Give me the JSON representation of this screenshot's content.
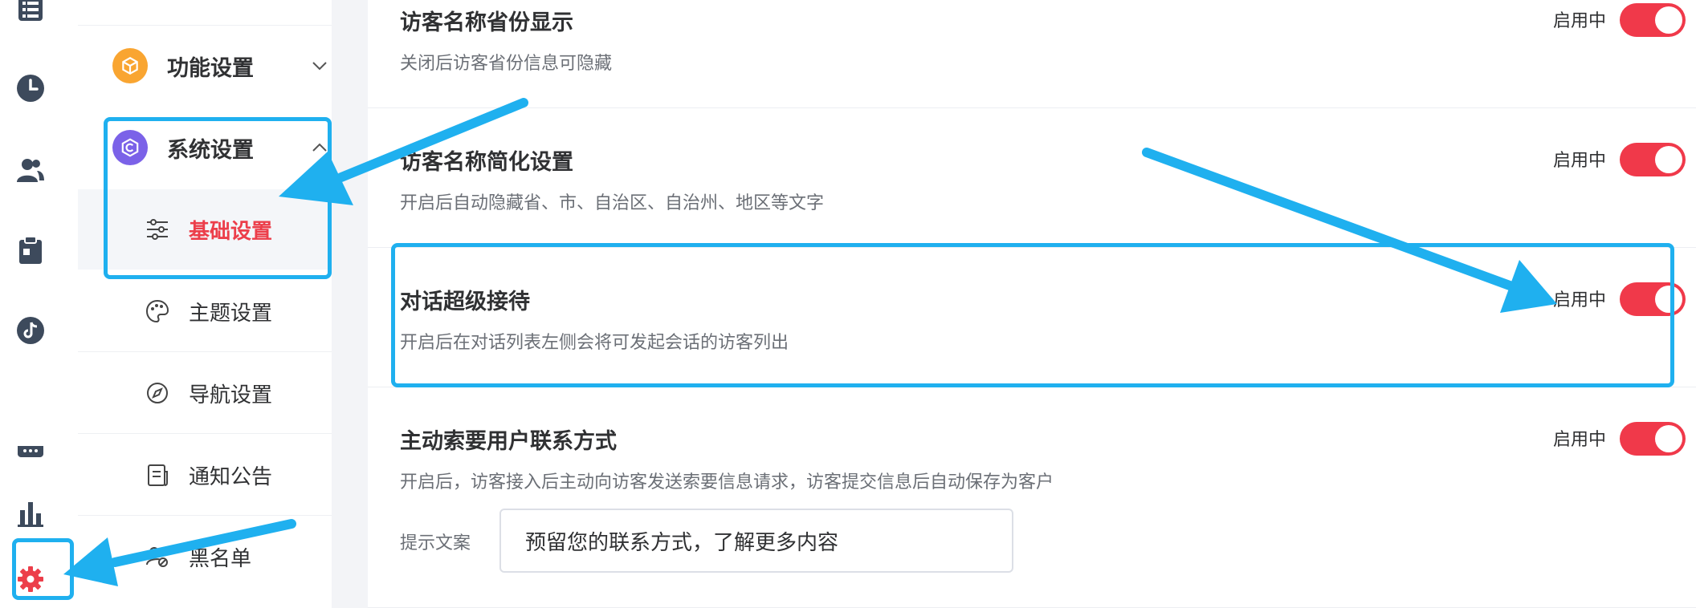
{
  "rail": {
    "items": [
      {
        "name": "list-icon"
      },
      {
        "name": "clock-icon"
      },
      {
        "name": "users-icon"
      },
      {
        "name": "clipboard-icon"
      },
      {
        "name": "tiktok-icon"
      },
      {
        "name": "chat-icon"
      },
      {
        "name": "bar-chart-icon"
      },
      {
        "name": "gear-icon",
        "active": true
      }
    ]
  },
  "sidebar": {
    "groups": [
      {
        "label": "功能设置",
        "icon": "cube-icon",
        "color": "#f9a531",
        "expanded": false
      },
      {
        "label": "系统设置",
        "icon": "system-hex-icon",
        "color": "#7b62e8",
        "expanded": true
      }
    ],
    "items": [
      {
        "label": "基础设置",
        "icon": "sliders-icon",
        "active": true
      },
      {
        "label": "主题设置",
        "icon": "palette-icon"
      },
      {
        "label": "导航设置",
        "icon": "compass-icon"
      },
      {
        "label": "通知公告",
        "icon": "document-icon"
      },
      {
        "label": "黑名单",
        "icon": "block-icon"
      }
    ]
  },
  "settings": [
    {
      "title": "访客名称省份显示",
      "desc": "关闭后访客省份信息可隐藏",
      "status": "启用中",
      "enabled": true
    },
    {
      "title": "访客名称简化设置",
      "desc": "开启后自动隐藏省、市、自治区、自治州、地区等文字",
      "status": "启用中",
      "enabled": true
    },
    {
      "title": "对话超级接待",
      "desc": "开启后在对话列表左侧会将可发起会话的访客列出",
      "status": "启用中",
      "enabled": true
    },
    {
      "title": "主动索要用户联系方式",
      "desc": "开启后，访客接入后主动向访客发送索要信息请求，访客提交信息后自动保存为客户",
      "status": "启用中",
      "enabled": true
    }
  ],
  "prompt": {
    "label": "提示文案",
    "value": "预留您的联系方式，了解更多内容"
  },
  "colors": {
    "accent": "#ec3e4a",
    "toggle_on": "#f0394a",
    "annotation": "#1fb0ef",
    "rail_icon": "#3d4a5c"
  }
}
